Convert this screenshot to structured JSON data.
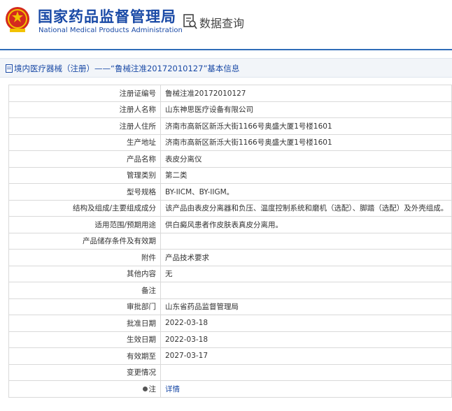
{
  "header": {
    "title_cn": "国家药品监督管理局",
    "title_en": "National Medical Products Administration",
    "query_label": "数据查询",
    "brand_color": "#1a4aa6"
  },
  "breadcrumb": {
    "text": "境内医疗器械（注册）——“鲁械注准20172010127”基本信息"
  },
  "table": {
    "rows": [
      {
        "label": "注册证编号",
        "value": "鲁械注准20172010127"
      },
      {
        "label": "注册人名称",
        "value": "山东神思医疗设备有限公司"
      },
      {
        "label": "注册人住所",
        "value": "济南市高新区新泺大街1166号奥盛大厦1号楼1601"
      },
      {
        "label": "生产地址",
        "value": "济南市高新区新泺大街1166号奥盛大厦1号楼1601"
      },
      {
        "label": "产品名称",
        "value": "表皮分离仪"
      },
      {
        "label": "管理类别",
        "value": "第二类"
      },
      {
        "label": "型号规格",
        "value": "BY-IICM、BY-IIGM。"
      },
      {
        "label": "结构及组成/主要组成成分",
        "value": "该产品由表皮分离器和负压、温度控制系统和磨机（选配）、脚踏（选配）及外壳组成。"
      },
      {
        "label": "适用范围/预期用途",
        "value": "供白癜风患者作皮肤表真皮分离用。"
      },
      {
        "label": "产品储存条件及有效期",
        "value": ""
      },
      {
        "label": "附件",
        "value": "产品技术要求"
      },
      {
        "label": "其他内容",
        "value": "无"
      },
      {
        "label": "备注",
        "value": ""
      },
      {
        "label": "审批部门",
        "value": "山东省药品监督管理局"
      },
      {
        "label": "批准日期",
        "value": "2022-03-18"
      },
      {
        "label": "生效日期",
        "value": "2022-03-18"
      },
      {
        "label": "有效期至",
        "value": "2027-03-17"
      },
      {
        "label": "变更情况",
        "value": ""
      }
    ],
    "note_row": {
      "label": "注",
      "link": "详情"
    }
  }
}
